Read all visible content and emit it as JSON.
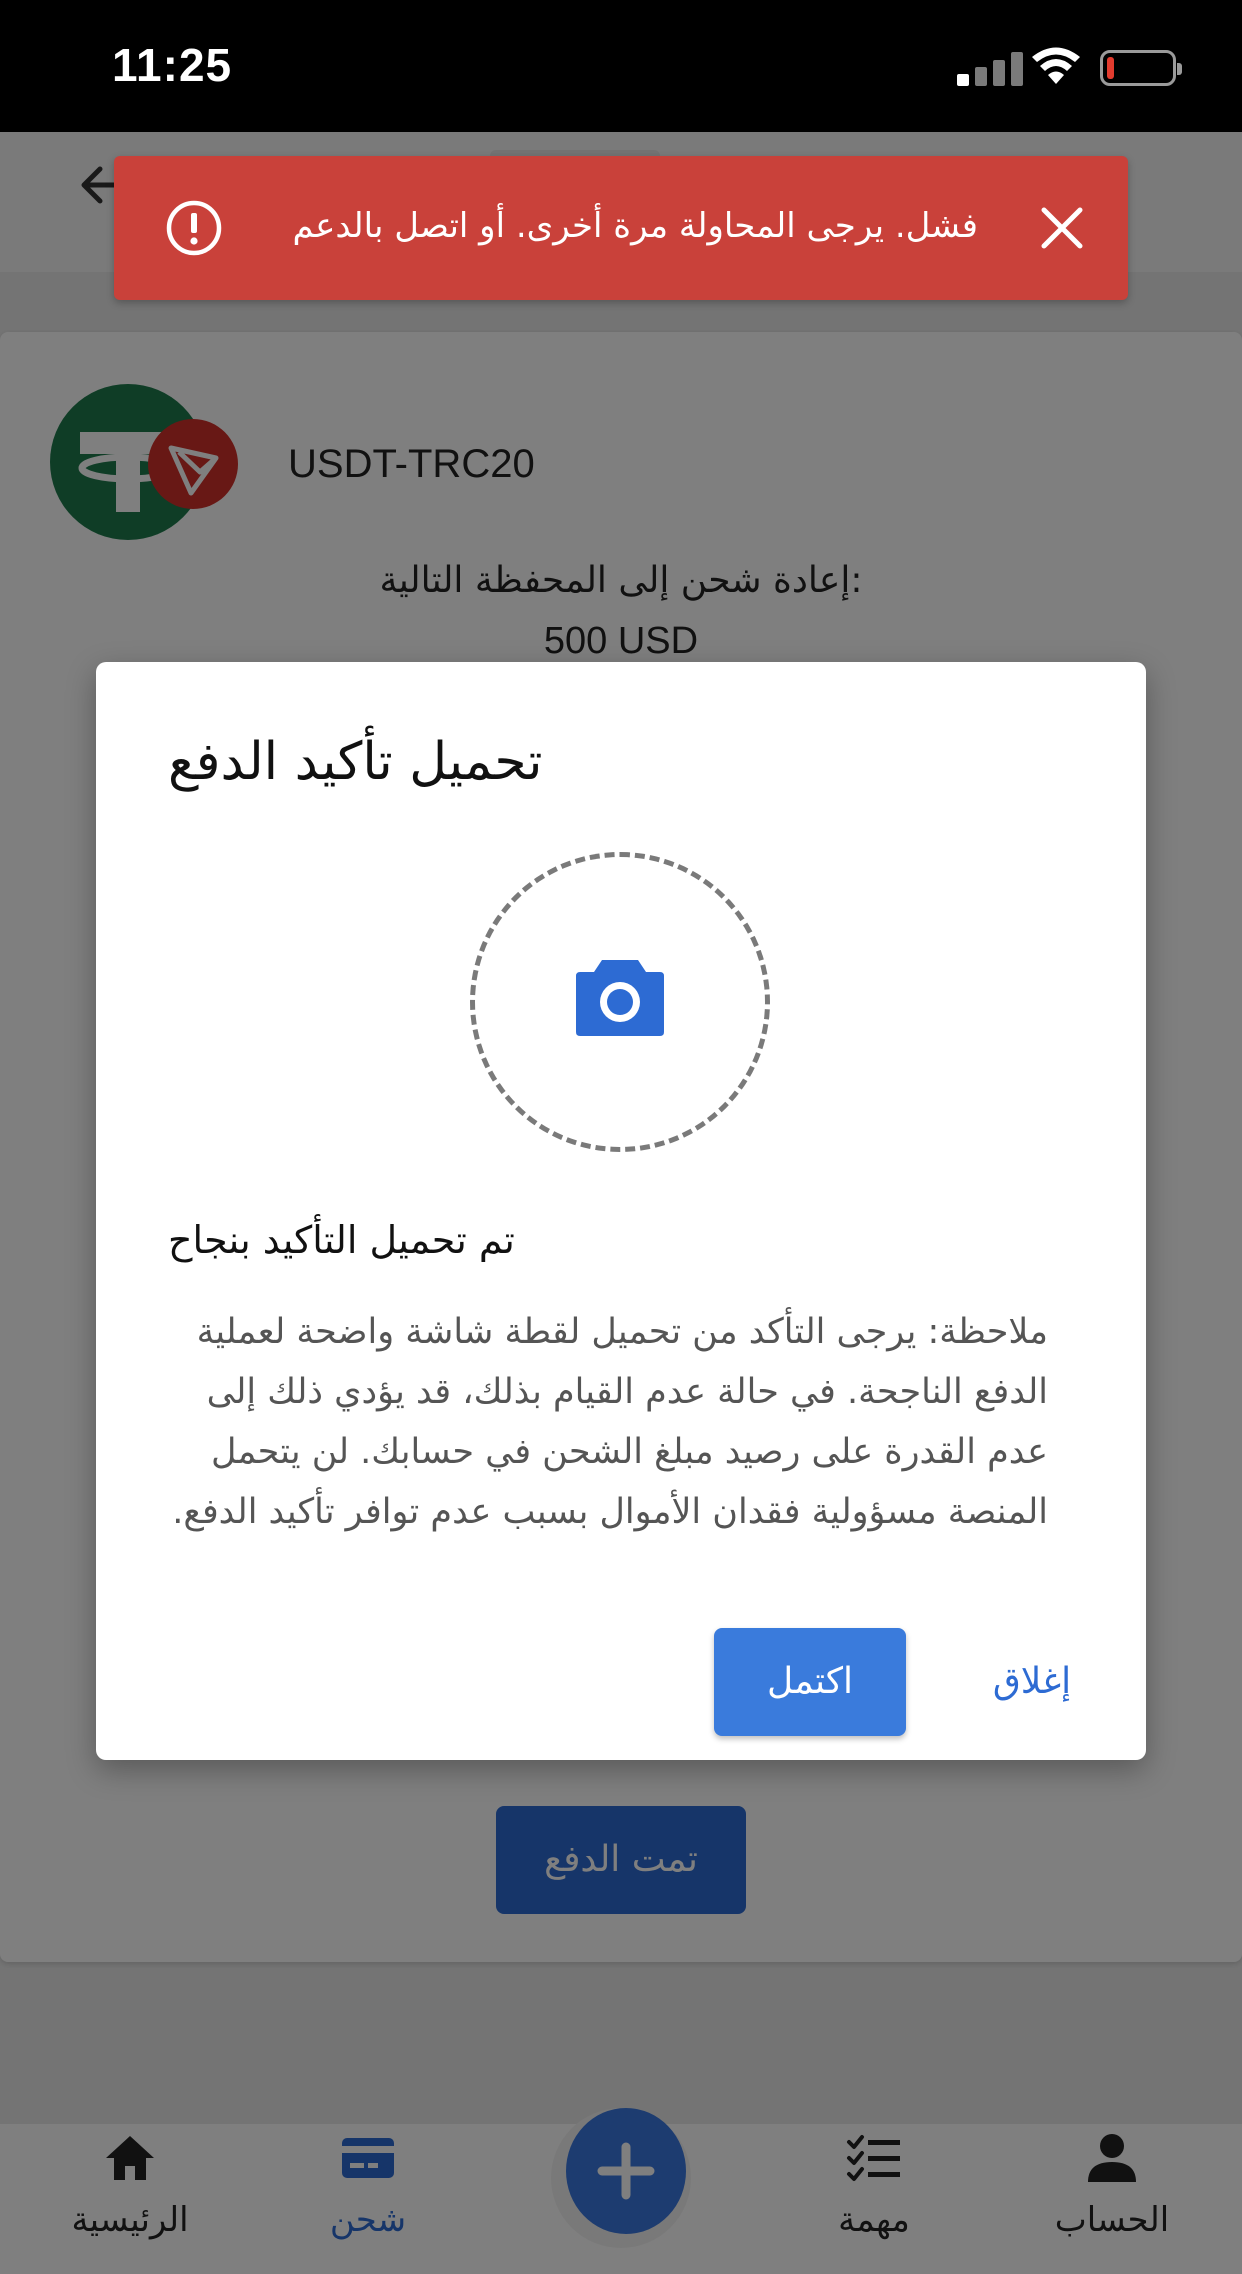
{
  "status_bar": {
    "time": "11:25"
  },
  "card": {
    "coin_name": "USDT-TRC20",
    "recharge_title": ":إعادة شحن إلى المحفظة التالية",
    "recharge_amount": "500 USD",
    "paid_button_label": "تمت الدفع"
  },
  "toast": {
    "message": "فشل. يرجى المحاولة مرة أخرى. أو اتصل بالدعم",
    "color": "#c9413a"
  },
  "dialog": {
    "title": "تحميل تأكيد الدفع",
    "success_text": "تم تحميل التأكيد بنجاح",
    "note": "ملاحظة: يرجى التأكد من تحميل لقطة شاشة واضحة لعملية الدفع الناجحة. في حالة عدم القيام بذلك، قد يؤدي ذلك إلى عدم القدرة على رصيد مبلغ الشحن في حسابك. لن يتحمل المنصة مسؤولية فقدان الأموال بسبب عدم توافر تأكيد الدفع.",
    "complete_label": "اكتمل",
    "close_label": "إغلاق"
  },
  "bottom_nav": {
    "items": [
      {
        "label": "الرئيسية",
        "icon": "home-icon"
      },
      {
        "label": "شحن",
        "icon": "card-icon",
        "active": true
      },
      {
        "label": "مهمة",
        "icon": "checklist-icon"
      },
      {
        "label": "الحساب",
        "icon": "person-icon"
      }
    ],
    "fab_icon": "plus-icon"
  },
  "colors": {
    "accent": "#2d6bd3",
    "error": "#c9413a",
    "tether_green": "#1f7a4d",
    "tron_red": "#d0312a"
  }
}
